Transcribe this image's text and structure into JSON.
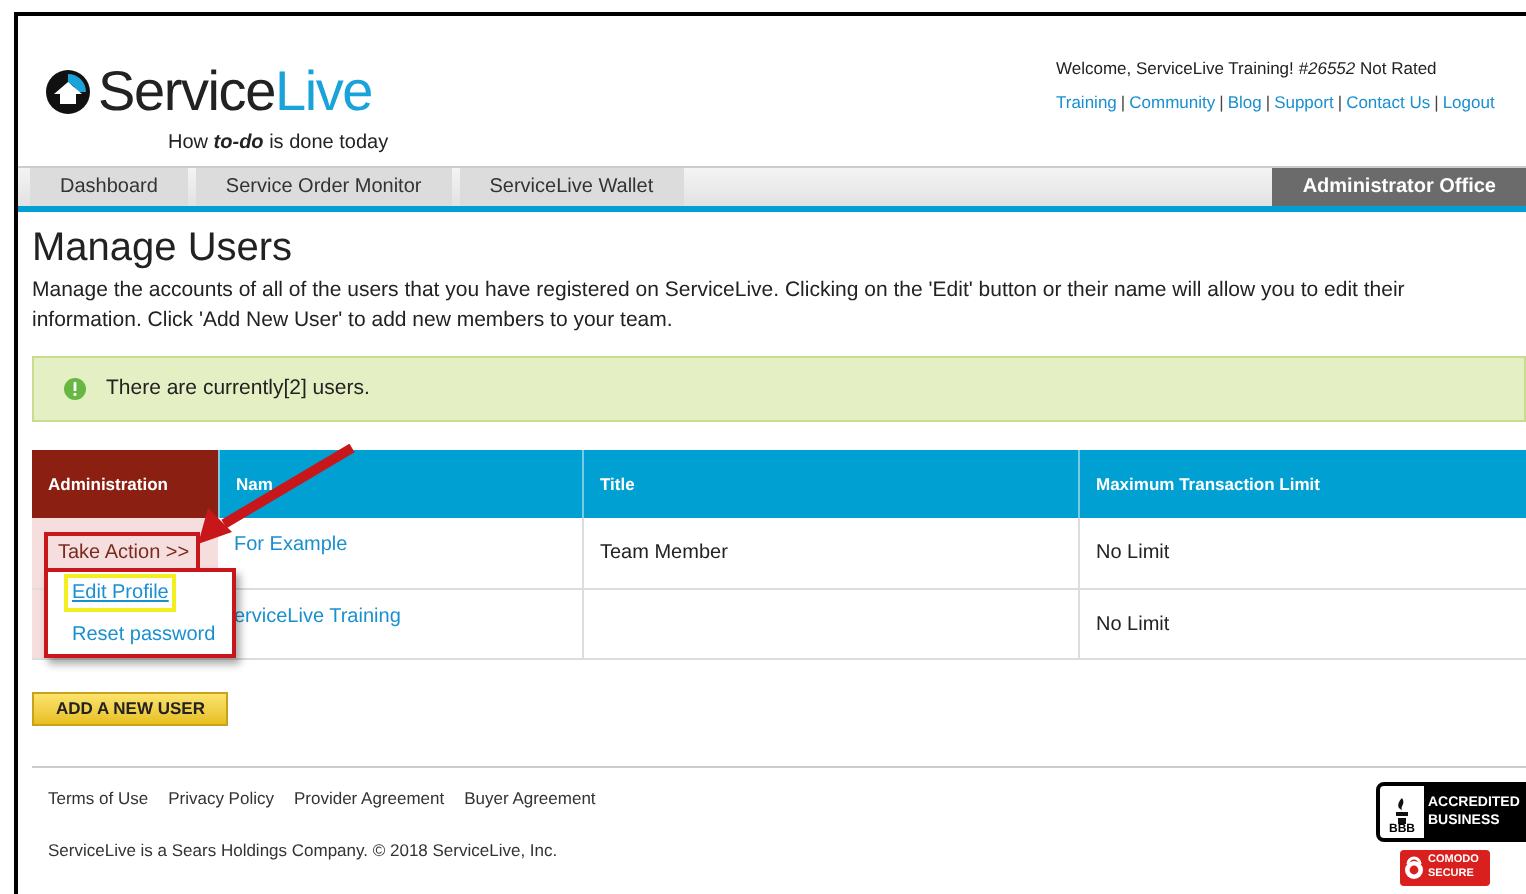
{
  "header": {
    "brand_dark": "Service",
    "brand_light": "Live",
    "tagline": "How **to-do** is done today",
    "welcome": "Welcome, ServiceLive Training! *#26552* Not Rated",
    "links": [
      "Training",
      "Community",
      "Blog",
      "Support",
      "Contact Us",
      "Logout"
    ],
    "link_separator": "|"
  },
  "tabs": [
    {
      "label": "Dashboard",
      "selected": false
    },
    {
      "label": "Service Order Monitor",
      "selected": false
    },
    {
      "label": "ServiceLive Wallet",
      "selected": false
    },
    {
      "label": "Administrator Office",
      "selected": true
    }
  ],
  "page": {
    "title": "Manage Users",
    "description": "Manage the accounts of all of the users that you have registered on ServiceLive. Clicking on the 'Edit' button or their name will allow you to edit their information. Click 'Add New User' to add new members to your team.",
    "alert": "There are currently[2] users."
  },
  "table": {
    "columns": [
      "Administration",
      "Nam",
      "Title",
      "Maximum Transaction Limit"
    ],
    "rows": [
      {
        "name": "For Example",
        "title": "Team Member",
        "limit": "No Limit"
      },
      {
        "name": "erviceLive Training",
        "limit": "No Limit"
      }
    ]
  },
  "action_menu": {
    "trigger": "Take Action >>",
    "items": [
      {
        "label": "Edit Profile",
        "highlighted": true
      },
      {
        "label": "Reset password",
        "highlighted": false
      }
    ]
  },
  "add_button": "ADD A NEW USER",
  "footer": {
    "links": [
      "Terms of Use",
      "Privacy Policy",
      "Provider Agreement",
      "Buyer Agreement"
    ],
    "copyright": "ServiceLive is a Sears Holdings Company. © 2018 ServiceLive, Inc.",
    "bbb": {
      "mark": "BBB",
      "line_1": "ACCREDITED",
      "line_2": "BUSINESS"
    },
    "comodo": {
      "line_1": "COMODO",
      "line_2": "SECURE"
    }
  }
}
